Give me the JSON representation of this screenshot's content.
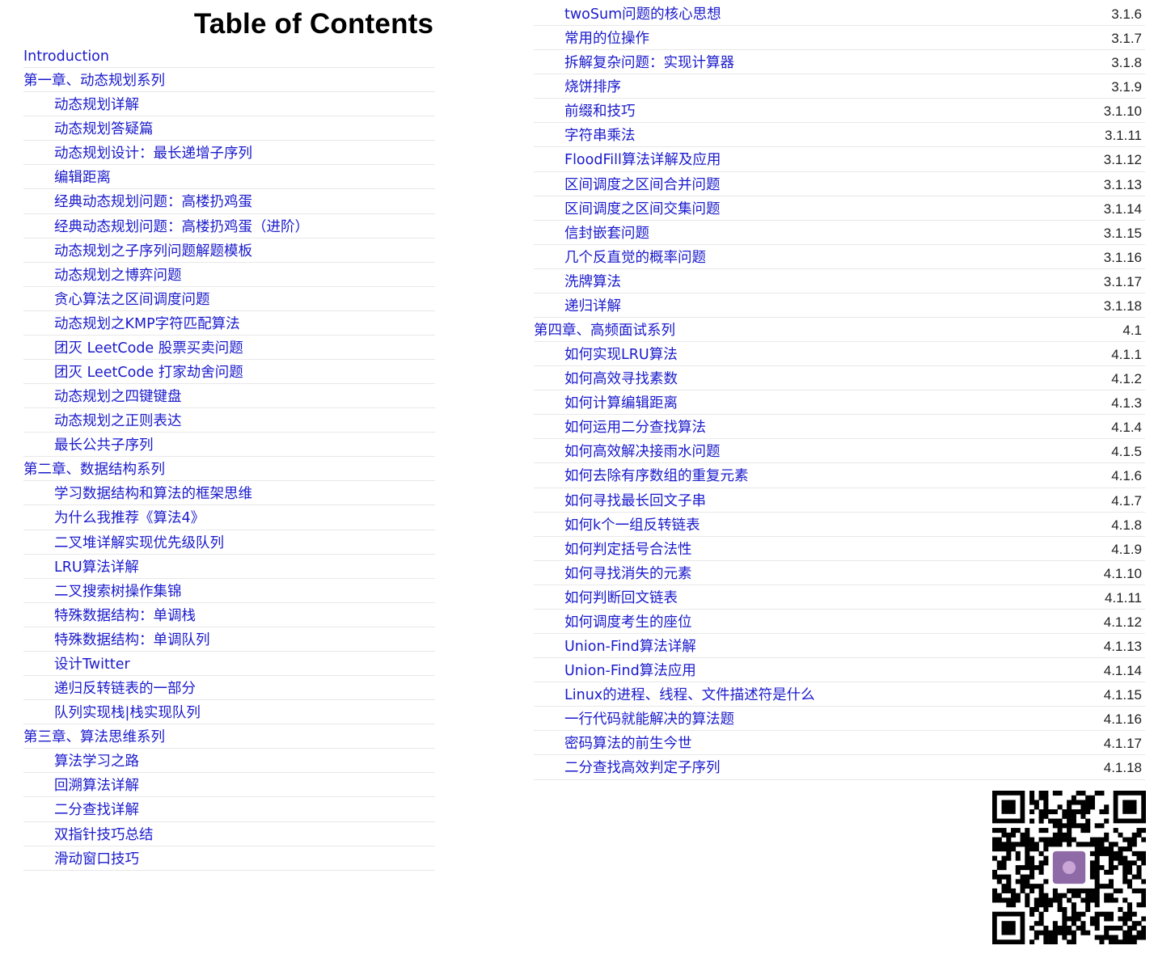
{
  "page_title": "Table of Contents",
  "left_entries": [
    {
      "label": "Introduction",
      "level": 1
    },
    {
      "label": "第一章、动态规划系列",
      "level": 1
    },
    {
      "label": "动态规划详解",
      "level": 2
    },
    {
      "label": "动态规划答疑篇",
      "level": 2
    },
    {
      "label": "动态规划设计：最长递增子序列",
      "level": 2
    },
    {
      "label": "编辑距离",
      "level": 2
    },
    {
      "label": "经典动态规划问题：高楼扔鸡蛋",
      "level": 2
    },
    {
      "label": "经典动态规划问题：高楼扔鸡蛋（进阶）",
      "level": 2
    },
    {
      "label": "动态规划之子序列问题解题模板",
      "level": 2
    },
    {
      "label": "动态规划之博弈问题",
      "level": 2
    },
    {
      "label": "贪心算法之区间调度问题",
      "level": 2
    },
    {
      "label": "动态规划之KMP字符匹配算法",
      "level": 2
    },
    {
      "label": "团灭 LeetCode 股票买卖问题",
      "level": 2
    },
    {
      "label": "团灭 LeetCode 打家劫舍问题",
      "level": 2
    },
    {
      "label": "动态规划之四键键盘",
      "level": 2
    },
    {
      "label": "动态规划之正则表达",
      "level": 2
    },
    {
      "label": "最长公共子序列",
      "level": 2
    },
    {
      "label": "第二章、数据结构系列",
      "level": 1
    },
    {
      "label": "学习数据结构和算法的框架思维",
      "level": 2
    },
    {
      "label": "为什么我推荐《算法4》",
      "level": 2
    },
    {
      "label": "二叉堆详解实现优先级队列",
      "level": 2
    },
    {
      "label": "LRU算法详解",
      "level": 2
    },
    {
      "label": "二叉搜索树操作集锦",
      "level": 2
    },
    {
      "label": "特殊数据结构：单调栈",
      "level": 2
    },
    {
      "label": "特殊数据结构：单调队列",
      "level": 2
    },
    {
      "label": "设计Twitter",
      "level": 2
    },
    {
      "label": "递归反转链表的一部分",
      "level": 2
    },
    {
      "label": "队列实现栈|栈实现队列",
      "level": 2
    },
    {
      "label": "第三章、算法思维系列",
      "level": 1
    },
    {
      "label": "算法学习之路",
      "level": 2
    },
    {
      "label": "回溯算法详解",
      "level": 2
    },
    {
      "label": "二分查找详解",
      "level": 2
    },
    {
      "label": "双指针技巧总结",
      "level": 2
    },
    {
      "label": "滑动窗口技巧",
      "level": 2
    }
  ],
  "right_entries": [
    {
      "label": "twoSum问题的核心思想",
      "num": "3.1.6",
      "level": 2
    },
    {
      "label": "常用的位操作",
      "num": "3.1.7",
      "level": 2
    },
    {
      "label": "拆解复杂问题：实现计算器",
      "num": "3.1.8",
      "level": 2
    },
    {
      "label": "烧饼排序",
      "num": "3.1.9",
      "level": 2
    },
    {
      "label": "前缀和技巧",
      "num": "3.1.10",
      "level": 2
    },
    {
      "label": "字符串乘法",
      "num": "3.1.11",
      "level": 2
    },
    {
      "label": "FloodFill算法详解及应用",
      "num": "3.1.12",
      "level": 2
    },
    {
      "label": "区间调度之区间合并问题",
      "num": "3.1.13",
      "level": 2
    },
    {
      "label": "区间调度之区间交集问题",
      "num": "3.1.14",
      "level": 2
    },
    {
      "label": "信封嵌套问题",
      "num": "3.1.15",
      "level": 2
    },
    {
      "label": "几个反直觉的概率问题",
      "num": "3.1.16",
      "level": 2
    },
    {
      "label": "洗牌算法",
      "num": "3.1.17",
      "level": 2
    },
    {
      "label": "递归详解",
      "num": "3.1.18",
      "level": 2
    },
    {
      "label": "第四章、高频面试系列",
      "num": "4.1",
      "level": 1
    },
    {
      "label": "如何实现LRU算法",
      "num": "4.1.1",
      "level": 2
    },
    {
      "label": "如何高效寻找素数",
      "num": "4.1.2",
      "level": 2
    },
    {
      "label": "如何计算编辑距离",
      "num": "4.1.3",
      "level": 2
    },
    {
      "label": "如何运用二分查找算法",
      "num": "4.1.4",
      "level": 2
    },
    {
      "label": "如何高效解决接雨水问题",
      "num": "4.1.5",
      "level": 2
    },
    {
      "label": "如何去除有序数组的重复元素",
      "num": "4.1.6",
      "level": 2
    },
    {
      "label": "如何寻找最长回文子串",
      "num": "4.1.7",
      "level": 2
    },
    {
      "label": "如何k个一组反转链表",
      "num": "4.1.8",
      "level": 2
    },
    {
      "label": "如何判定括号合法性",
      "num": "4.1.9",
      "level": 2
    },
    {
      "label": "如何寻找消失的元素",
      "num": "4.1.10",
      "level": 2
    },
    {
      "label": "如何判断回文链表",
      "num": "4.1.11",
      "level": 2
    },
    {
      "label": "如何调度考生的座位",
      "num": "4.1.12",
      "level": 2
    },
    {
      "label": "Union-Find算法详解",
      "num": "4.1.13",
      "level": 2
    },
    {
      "label": "Union-Find算法应用",
      "num": "4.1.14",
      "level": 2
    },
    {
      "label": "Linux的进程、线程、文件描述符是什么",
      "num": "4.1.15",
      "level": 2
    },
    {
      "label": "一行代码就能解决的算法题",
      "num": "4.1.16",
      "level": 2
    },
    {
      "label": "密码算法的前生今世",
      "num": "4.1.17",
      "level": 2
    },
    {
      "label": "二分查找高效判定子序列",
      "num": "4.1.18",
      "level": 2
    }
  ],
  "colors": {
    "link": "#1a1acc",
    "number": "#222222",
    "divider": "#e8e8e8",
    "qr_center": "#8e6aa6"
  },
  "qr_icon": "qr-code-image"
}
